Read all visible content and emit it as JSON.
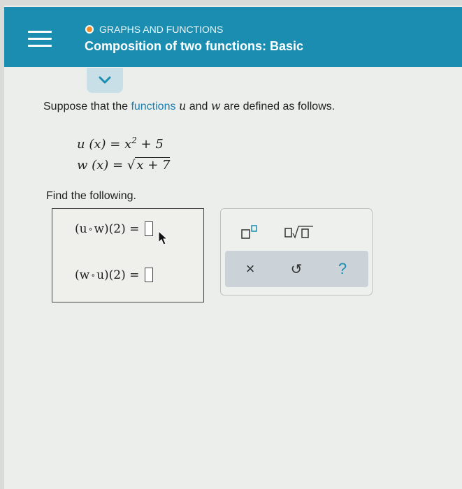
{
  "header": {
    "topic": "GRAPHS AND FUNCTIONS",
    "title": "Composition of two functions: Basic"
  },
  "problem": {
    "prefix": "Suppose that the ",
    "link": "functions",
    "var_u": "u",
    "and": " and ",
    "var_w": "w",
    "suffix": " are defined as follows."
  },
  "equations": {
    "u_def": "u (x) = x",
    "u_exp": "2",
    "u_tail": " + 5",
    "w_def": "w (x) = ",
    "w_radicand": "x + 7"
  },
  "find_label": "Find the following.",
  "answers": [
    {
      "open": "(u",
      "op": "∘",
      "inner": "w)(2) ="
    },
    {
      "open": "(w",
      "op": "∘",
      "inner": "u)(2) ="
    }
  ],
  "keypad": {
    "clear": "×",
    "undo": "↺",
    "help": "?"
  },
  "colors": {
    "header": "#1a8db0",
    "accent": "#f28c2a",
    "link": "#1a7fb0"
  }
}
